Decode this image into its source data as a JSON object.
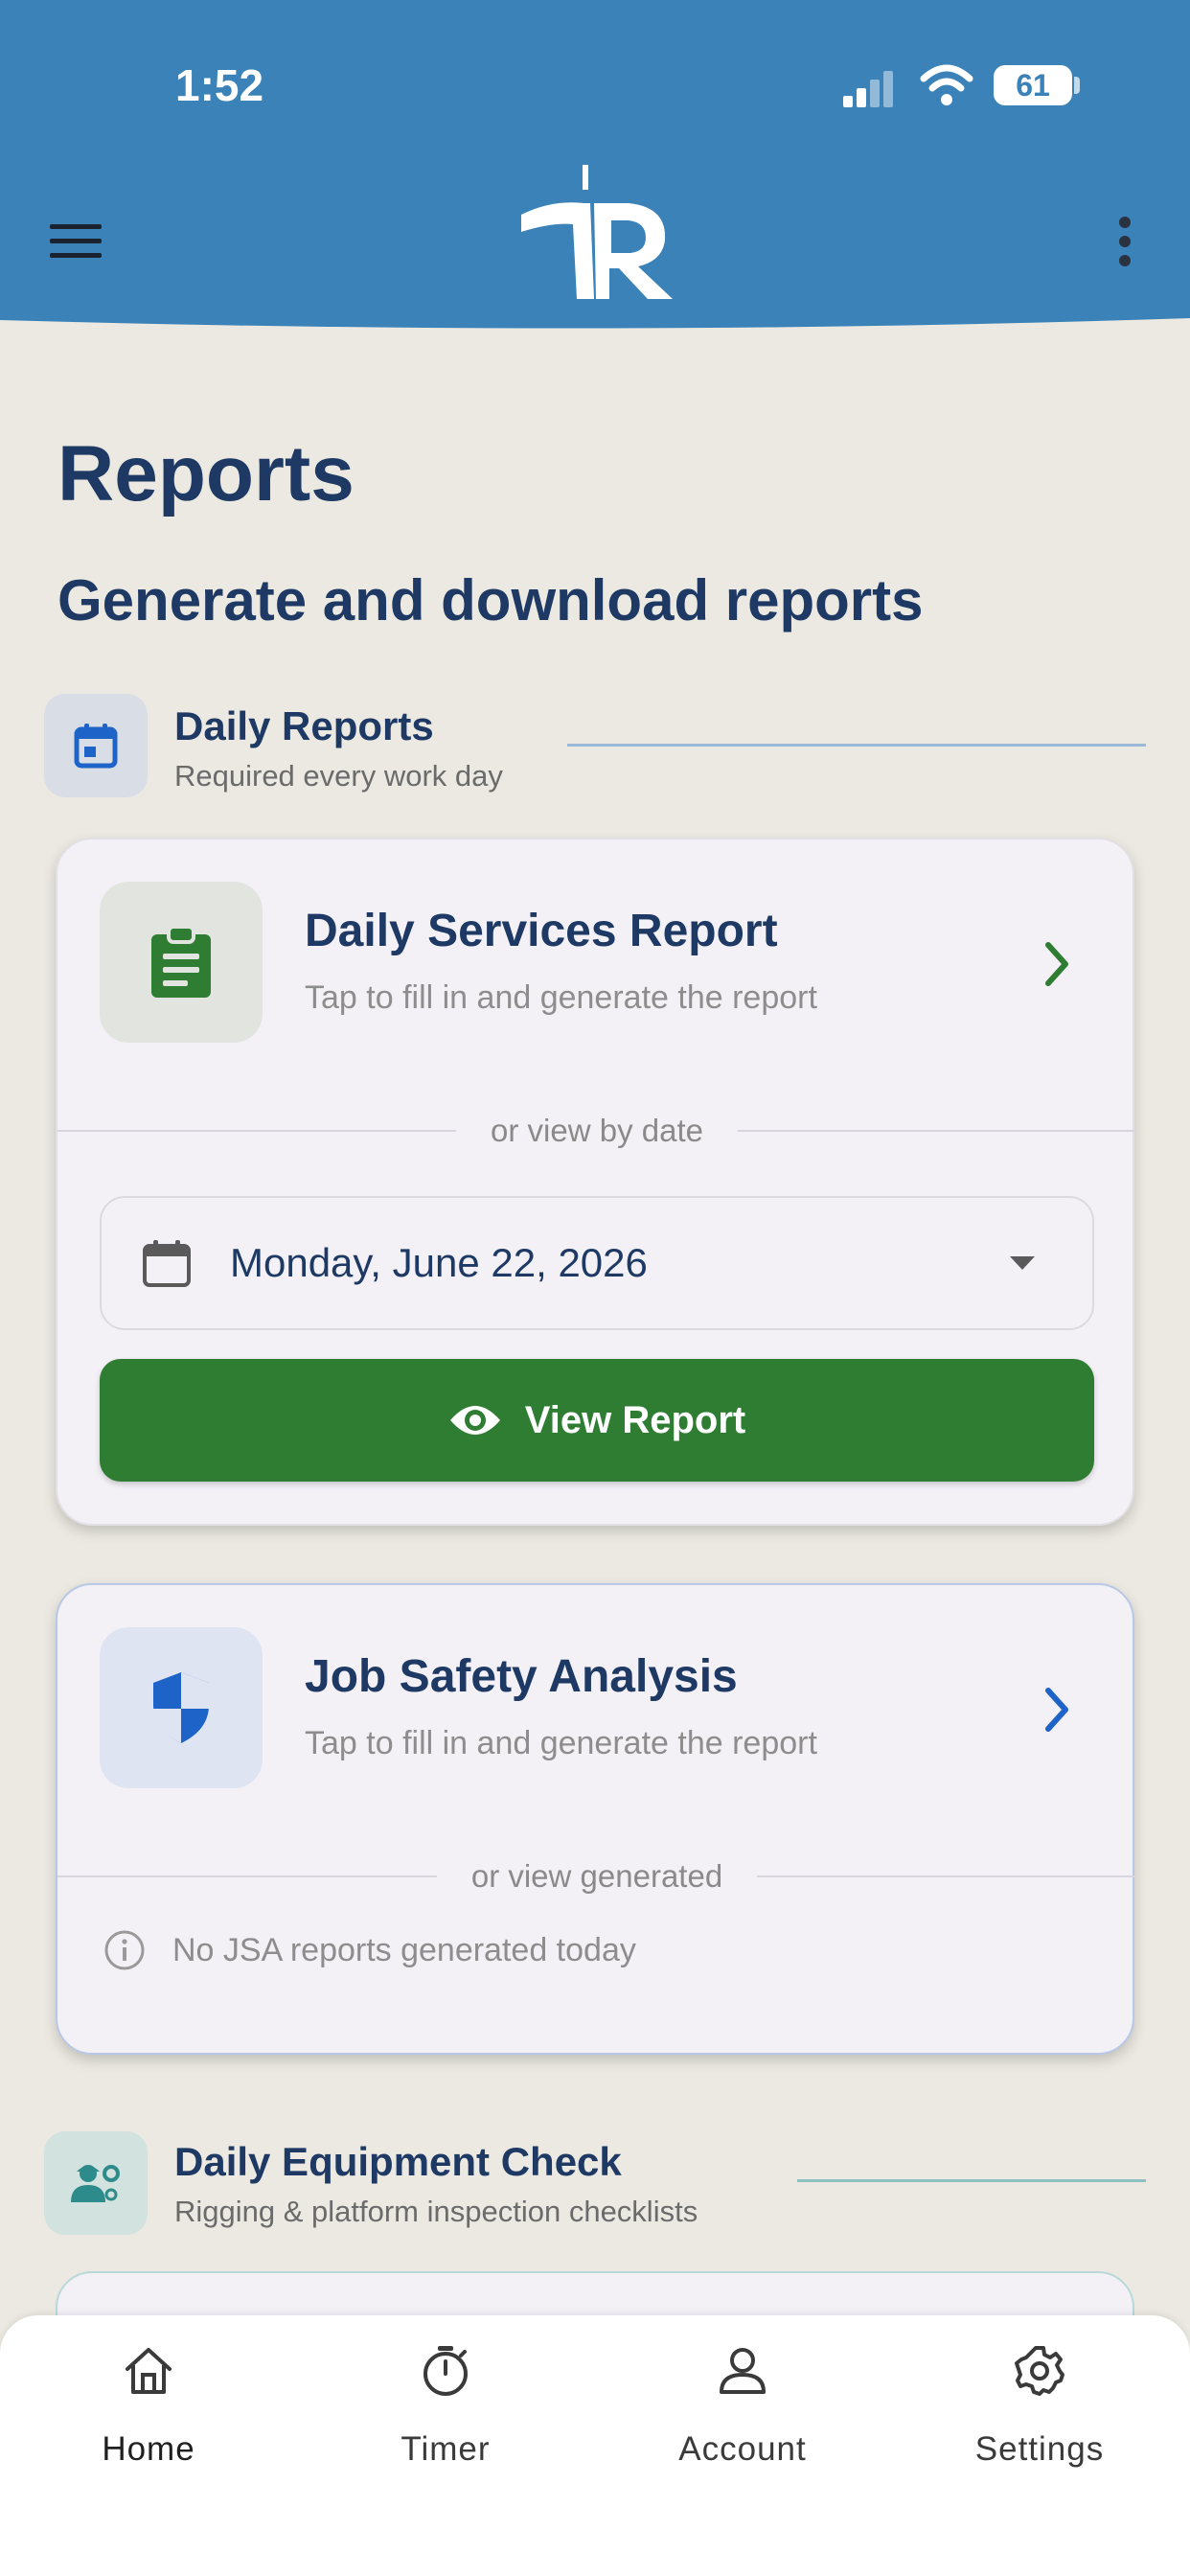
{
  "status_bar": {
    "time": "1:52",
    "battery": "61"
  },
  "page": {
    "title": "Reports",
    "subtitle": "Generate and download reports"
  },
  "sections": {
    "daily": {
      "title": "Daily Reports",
      "description": "Required every work day",
      "icon": "calendar-icon"
    },
    "equipment": {
      "title": "Daily Equipment Check",
      "description": "Rigging & platform inspection checklists",
      "icon": "worker-gear-icon"
    }
  },
  "cards": {
    "dsr": {
      "title": "Daily Services Report",
      "description": "Tap to fill in and generate the report",
      "divider": "or view by date",
      "date_value": "Monday, June 22, 2026",
      "button_label": "View Report",
      "icon": "clipboard-icon"
    },
    "jsa": {
      "title": "Job Safety Analysis",
      "description": "Tap to fill in and generate the report",
      "divider": "or view generated",
      "empty_message": "No JSA reports generated today",
      "icon": "shield-icon"
    }
  },
  "nav": {
    "items": [
      {
        "label": "Home",
        "icon": "home-icon",
        "active": true
      },
      {
        "label": "Timer",
        "icon": "timer-icon"
      },
      {
        "label": "Account",
        "icon": "account-icon"
      },
      {
        "label": "Settings",
        "icon": "gear-icon"
      }
    ]
  },
  "colors": {
    "header": "#3a82b8",
    "navy": "#1e3a64",
    "green": "#2e7d32",
    "blue_accent": "#1e63c8",
    "teal": "#2e8b8b"
  }
}
